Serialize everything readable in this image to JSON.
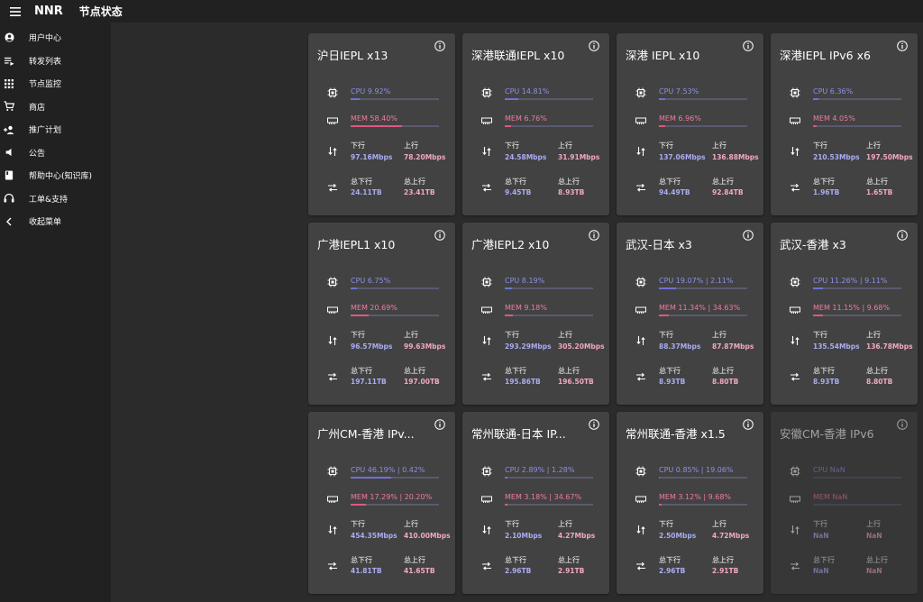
{
  "topbar": {
    "app_name": "NNR",
    "page_title": "节点状态"
  },
  "sidebar": {
    "items": [
      {
        "label": "用户中心",
        "icon": "account-circle-icon"
      },
      {
        "label": "转发列表",
        "icon": "playlist-icon"
      },
      {
        "label": "节点监控",
        "icon": "apps-grid-icon"
      },
      {
        "label": "商店",
        "icon": "cart-icon"
      },
      {
        "label": "推广计划",
        "icon": "add-user-icon"
      },
      {
        "label": "公告",
        "icon": "megaphone-icon"
      },
      {
        "label": "帮助中心(知识库)",
        "icon": "book-icon"
      },
      {
        "label": "工单&支持",
        "icon": "headset-icon"
      },
      {
        "label": "收起菜单",
        "icon": "chevron-left-icon"
      }
    ]
  },
  "labels": {
    "down": "下行",
    "up": "上行",
    "total_down": "总下行",
    "total_up": "总上行"
  },
  "colors": {
    "cpu": "#6d72d6",
    "mem": "#e0577f",
    "card": "#424242",
    "background": "#2b2b2b",
    "sidebar": "#212121"
  },
  "nodes": [
    {
      "title": "沪日IEPL x13",
      "cpu_text": "CPU 9.92%",
      "cpu": 0.0992,
      "mem_text": "MEM 58.40%",
      "mem": 0.584,
      "down": "97.16Mbps",
      "up": "78.20Mbps",
      "total_down": "24.11TB",
      "total_up": "23.41TB",
      "online": true
    },
    {
      "title": "深港联通IEPL x10",
      "cpu_text": "CPU 14.81%",
      "cpu": 0.1481,
      "mem_text": "MEM 6.76%",
      "mem": 0.0676,
      "down": "24.58Mbps",
      "up": "31.91Mbps",
      "total_down": "9.45TB",
      "total_up": "8.93TB",
      "online": true
    },
    {
      "title": "深港 IEPL x10",
      "cpu_text": "CPU 7.53%",
      "cpu": 0.0753,
      "mem_text": "MEM 6.96%",
      "mem": 0.0696,
      "down": "137.06Mbps",
      "up": "136.88Mbps",
      "total_down": "94.49TB",
      "total_up": "92.84TB",
      "online": true
    },
    {
      "title": "深港IEPL IPv6 x6",
      "cpu_text": "CPU 6.36%",
      "cpu": 0.0636,
      "mem_text": "MEM 4.05%",
      "mem": 0.0405,
      "down": "210.53Mbps",
      "up": "197.50Mbps",
      "total_down": "1.96TB",
      "total_up": "1.65TB",
      "online": true
    },
    {
      "title": "广港IEPL1 x10",
      "cpu_text": "CPU 6.75%",
      "cpu": 0.0675,
      "mem_text": "MEM 20.69%",
      "mem": 0.2069,
      "down": "96.57Mbps",
      "up": "99.63Mbps",
      "total_down": "197.11TB",
      "total_up": "197.00TB",
      "online": true
    },
    {
      "title": "广港IEPL2 x10",
      "cpu_text": "CPU 8.19%",
      "cpu": 0.0819,
      "mem_text": "MEM 9.18%",
      "mem": 0.0918,
      "down": "293.29Mbps",
      "up": "305.20Mbps",
      "total_down": "195.86TB",
      "total_up": "196.50TB",
      "online": true
    },
    {
      "title": "武汉-日本 x3",
      "cpu_text": "CPU 19.07% | 2.11%",
      "cpu": 0.1907,
      "mem_text": "MEM 11.34% | 34.63%",
      "mem": 0.1134,
      "down": "88.37Mbps",
      "up": "87.87Mbps",
      "total_down": "8.93TB",
      "total_up": "8.80TB",
      "online": true
    },
    {
      "title": "武汉-香港 x3",
      "cpu_text": "CPU 11.26% | 9.11%",
      "cpu": 0.1126,
      "mem_text": "MEM 11.15% | 9.68%",
      "mem": 0.1115,
      "down": "135.54Mbps",
      "up": "136.78Mbps",
      "total_down": "8.93TB",
      "total_up": "8.80TB",
      "online": true
    },
    {
      "title": "广州CM-香港 IPv...",
      "cpu_text": "CPU 46.19% | 0.42%",
      "cpu": 0.4619,
      "mem_text": "MEM 17.29% | 20.20%",
      "mem": 0.1729,
      "down": "454.35Mbps",
      "up": "410.00Mbps",
      "total_down": "41.81TB",
      "total_up": "41.65TB",
      "online": true
    },
    {
      "title": "常州联通-日本 IP...",
      "cpu_text": "CPU 2.89% | 1.28%",
      "cpu": 0.0289,
      "mem_text": "MEM 3.18% | 34.67%",
      "mem": 0.0318,
      "down": "2.10Mbps",
      "up": "4.27Mbps",
      "total_down": "2.96TB",
      "total_up": "2.91TB",
      "online": true
    },
    {
      "title": "常州联通-香港 x1.5",
      "cpu_text": "CPU 0.85% | 19.06%",
      "cpu": 0.0085,
      "mem_text": "MEM 3.12% | 9.68%",
      "mem": 0.0312,
      "down": "2.50Mbps",
      "up": "4.72Mbps",
      "total_down": "2.96TB",
      "total_up": "2.91TB",
      "online": true
    },
    {
      "title": "安徽CM-香港 IPv6",
      "cpu_text": "CPU NaN",
      "cpu": 0,
      "mem_text": "MEM NaN",
      "mem": 0,
      "down": "NaN",
      "up": "NaN",
      "total_down": "NaN",
      "total_up": "NaN",
      "online": false
    }
  ]
}
